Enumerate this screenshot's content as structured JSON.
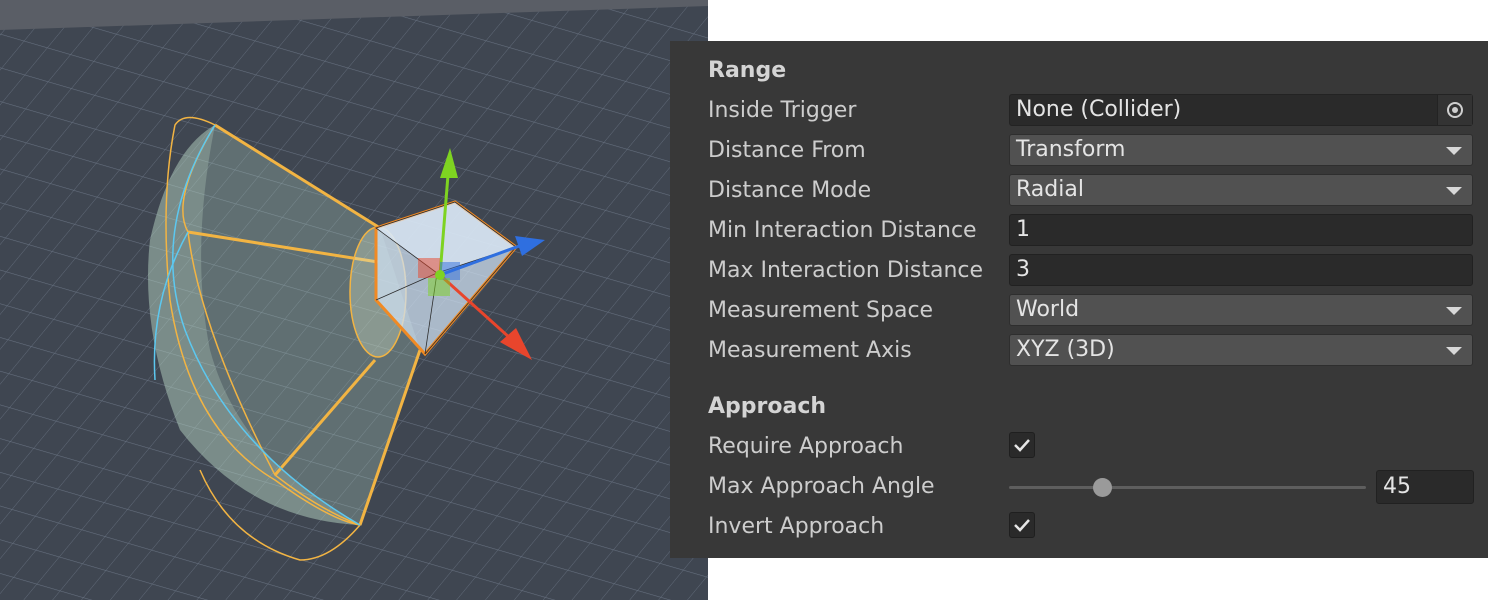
{
  "range": {
    "header": "Range",
    "inside_trigger": {
      "label": "Inside Trigger",
      "value": "None (Collider)",
      "icon": "object-picker-icon"
    },
    "distance_from": {
      "label": "Distance From",
      "value": "Transform"
    },
    "distance_mode": {
      "label": "Distance Mode",
      "value": "Radial"
    },
    "min_interaction_distance": {
      "label": "Min Interaction Distance",
      "value": "1"
    },
    "max_interaction_distance": {
      "label": "Max Interaction Distance",
      "value": "3"
    },
    "measurement_space": {
      "label": "Measurement Space",
      "value": "World"
    },
    "measurement_axis": {
      "label": "Measurement Axis",
      "value": "XYZ (3D)"
    }
  },
  "approach": {
    "header": "Approach",
    "require_approach": {
      "label": "Require Approach",
      "checked": true
    },
    "max_approach_angle": {
      "label": "Max Approach Angle",
      "value": "45",
      "slider_fraction": 0.26
    },
    "invert_approach": {
      "label": "Invert Approach",
      "checked": true
    }
  },
  "scene": {
    "gizmo_colors": {
      "y_axis": "#7ed321",
      "z_axis": "#2f6fe0",
      "x_axis": "#e8452c",
      "range_outline": "#f2b443",
      "angle_arc": "#5cc8f0"
    }
  }
}
